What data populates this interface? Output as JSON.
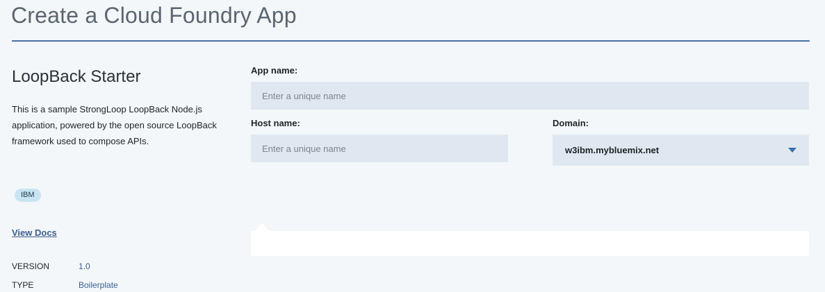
{
  "page": {
    "title": "Create a Cloud Foundry App"
  },
  "starter": {
    "title": "LoopBack Starter",
    "description": "This is a sample StrongLoop LoopBack Node.js application, powered by the open source LoopBack framework used to compose APIs.",
    "tag": "IBM",
    "view_docs_label": "View Docs",
    "meta": [
      {
        "key": "VERSION",
        "value": "1.0"
      },
      {
        "key": "TYPE",
        "value": "Boilerplate"
      }
    ]
  },
  "form": {
    "app_name": {
      "label": "App name:",
      "value": "",
      "placeholder": "Enter a unique name"
    },
    "host_name": {
      "label": "Host name:",
      "value": "",
      "placeholder": "Enter a unique name"
    },
    "domain": {
      "label": "Domain:",
      "selected": "w3ibm.mybluemix.net"
    }
  },
  "colors": {
    "background": "#f3f7f9",
    "field_background": "#dfe8f0",
    "accent": "#4a6fa5",
    "link": "#3b5f8f",
    "tag_background": "#c8e4f3"
  },
  "icons": {
    "domain_dropdown": "chevron-down-icon"
  }
}
